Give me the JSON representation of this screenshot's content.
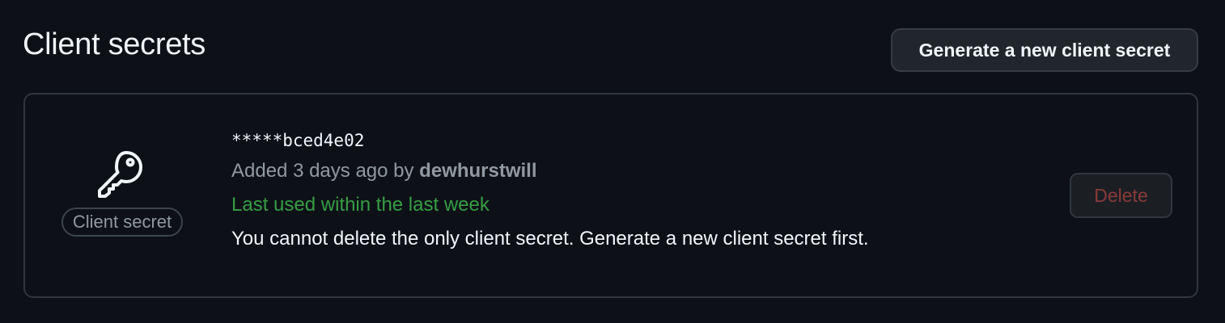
{
  "header": {
    "title": "Client secrets",
    "generate_button_label": "Generate a new client secret"
  },
  "secret": {
    "icon": "key-icon",
    "badge_label": "Client secret",
    "masked_value": "*****bced4e02",
    "added_prefix": "Added 3 days ago by ",
    "added_by": "dewhurstwill",
    "last_used": "Last used within the last week",
    "note": "You cannot delete the only client secret. Generate a new client secret first.",
    "delete_label": "Delete",
    "delete_disabled": true
  },
  "colors": {
    "background": "#0d1117",
    "last_used_green": "#3fb950",
    "delete_disabled_red": "#8a3a3a"
  }
}
